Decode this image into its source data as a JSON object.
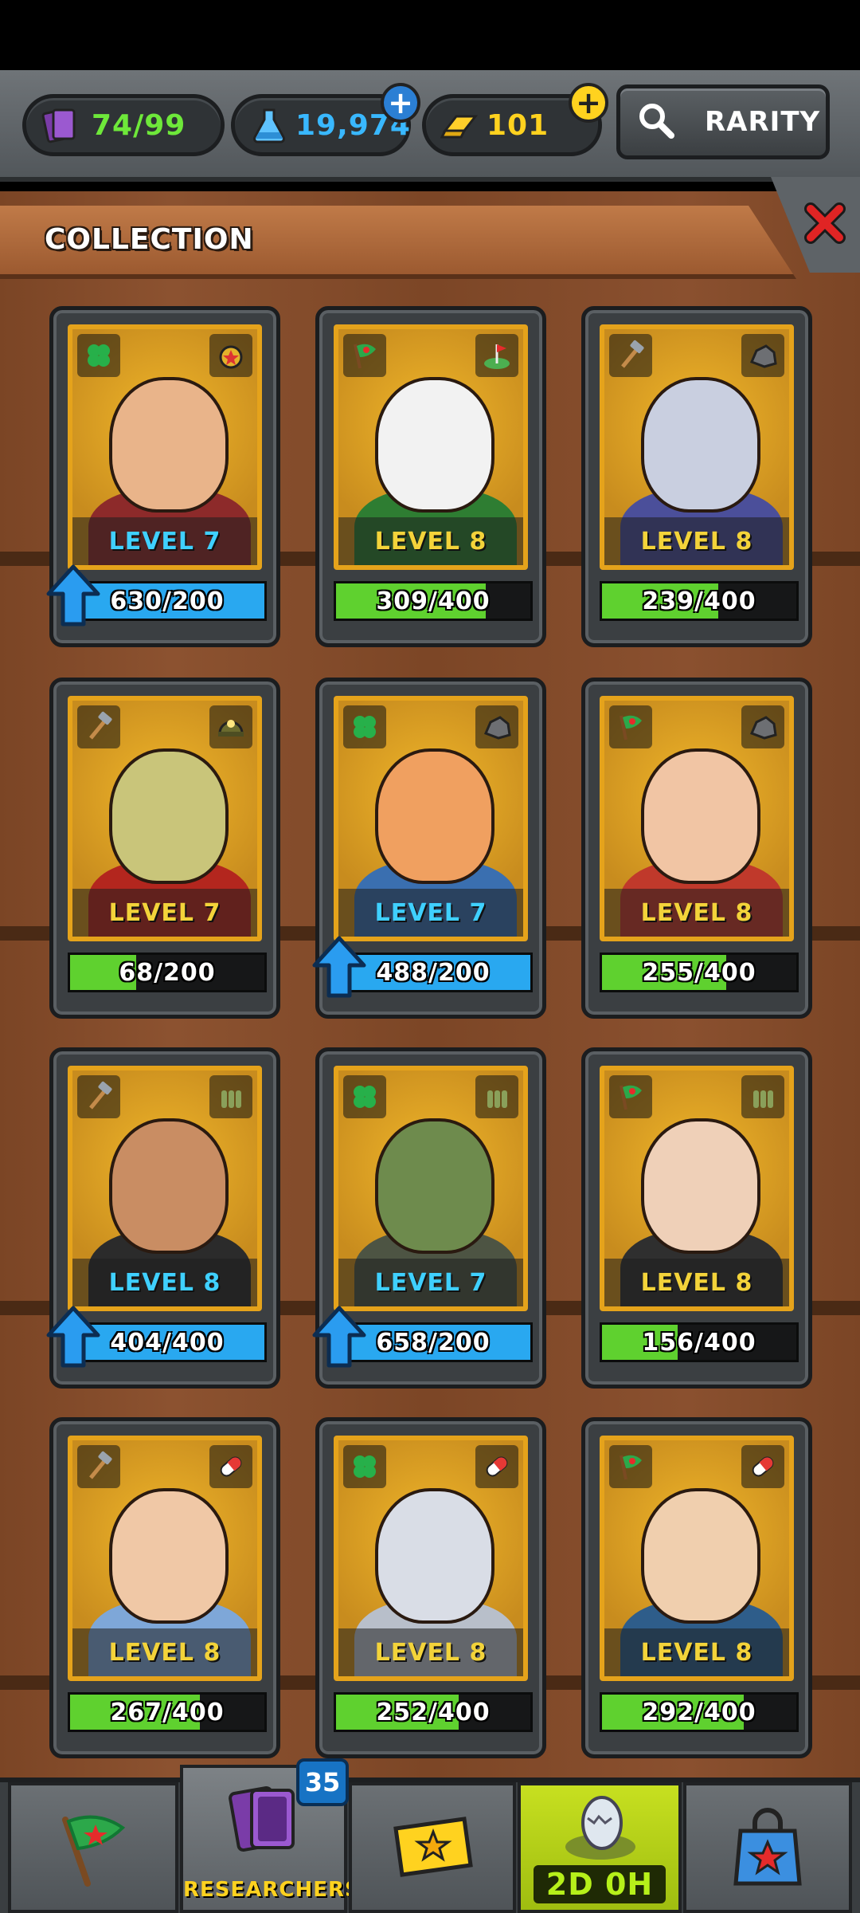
{
  "resources": {
    "cards": "74/99",
    "potion": "19,974",
    "gold": "101",
    "rarity_label": "RARITY"
  },
  "panel": {
    "title": "COLLECTION"
  },
  "cards": [
    {
      "level": "LEVEL 7",
      "progress": "630/200",
      "fraction": 1.0,
      "upgrade": true,
      "level_color": "#3fd0ff",
      "badge_left": "clover",
      "badge_right": "medal",
      "skin": "#e9b48a",
      "body": "#8d2a2a",
      "bg": "#c88c1e"
    },
    {
      "level": "LEVEL 8",
      "progress": "309/400",
      "fraction": 0.77,
      "upgrade": false,
      "level_color": "#f3d33a",
      "badge_left": "flag",
      "badge_right": "golf",
      "skin": "#f2f2f2",
      "body": "#2e7d32",
      "bg": "#c88c1e"
    },
    {
      "level": "LEVEL 8",
      "progress": "239/400",
      "fraction": 0.6,
      "upgrade": false,
      "level_color": "#f3d33a",
      "badge_left": "hammer",
      "badge_right": "rock",
      "skin": "#c9cfe0",
      "body": "#4b4f9a",
      "bg": "#c88c1e"
    },
    {
      "level": "LEVEL 7",
      "progress": "68/200",
      "fraction": 0.34,
      "upgrade": false,
      "level_color": "#f3d33a",
      "badge_left": "hammer",
      "badge_right": "helmet",
      "skin": "#c9c57a",
      "body": "#b3261e",
      "bg": "#c88c1e"
    },
    {
      "level": "LEVEL 7",
      "progress": "488/200",
      "fraction": 1.0,
      "upgrade": true,
      "level_color": "#3fd0ff",
      "badge_left": "clover",
      "badge_right": "rock",
      "skin": "#f0a060",
      "body": "#3a6fb0",
      "bg": "#c88c1e"
    },
    {
      "level": "LEVEL 8",
      "progress": "255/400",
      "fraction": 0.64,
      "upgrade": false,
      "level_color": "#f3d33a",
      "badge_left": "flag",
      "badge_right": "rock",
      "skin": "#f1c5a4",
      "body": "#c0392b",
      "bg": "#c88c1e"
    },
    {
      "level": "LEVEL 8",
      "progress": "404/400",
      "fraction": 1.0,
      "upgrade": true,
      "level_color": "#3fd0ff",
      "badge_left": "hammer",
      "badge_right": "ammo",
      "skin": "#c98d63",
      "body": "#2b2b2b",
      "bg": "#c88c1e"
    },
    {
      "level": "LEVEL 7",
      "progress": "658/200",
      "fraction": 1.0,
      "upgrade": true,
      "level_color": "#3fd0ff",
      "badge_left": "clover",
      "badge_right": "ammo",
      "skin": "#6e8b4d",
      "body": "#4d5443",
      "bg": "#c88c1e"
    },
    {
      "level": "LEVEL 8",
      "progress": "156/400",
      "fraction": 0.39,
      "upgrade": false,
      "level_color": "#f3d33a",
      "badge_left": "flag",
      "badge_right": "ammo",
      "skin": "#efd0b8",
      "body": "#2f2f2f",
      "bg": "#c88c1e"
    },
    {
      "level": "LEVEL 8",
      "progress": "267/400",
      "fraction": 0.67,
      "upgrade": false,
      "level_color": "#f3d33a",
      "badge_left": "hammer",
      "badge_right": "pill",
      "skin": "#f0c8a6",
      "body": "#7ea7d8",
      "bg": "#c88c1e"
    },
    {
      "level": "LEVEL 8",
      "progress": "252/400",
      "fraction": 0.63,
      "upgrade": false,
      "level_color": "#f3d33a",
      "badge_left": "clover",
      "badge_right": "pill",
      "skin": "#d9dde6",
      "body": "#b8bfca",
      "bg": "#c88c1e"
    },
    {
      "level": "LEVEL 8",
      "progress": "292/400",
      "fraction": 0.73,
      "upgrade": false,
      "level_color": "#f3d33a",
      "badge_left": "flag",
      "badge_right": "pill",
      "skin": "#f0cfae",
      "body": "#2e5d8a",
      "bg": "#c88c1e"
    }
  ],
  "nav": {
    "researchers_label": "RESEARCHERS",
    "researchers_count": "35",
    "timer_label": "2D 0H"
  },
  "colors": {
    "green_fill": "#5fd12f",
    "blue_fill": "#29a8f0",
    "cards_text": "#6ee83a",
    "potion_text": "#39b8ff",
    "gold_text": "#ffd21f"
  }
}
